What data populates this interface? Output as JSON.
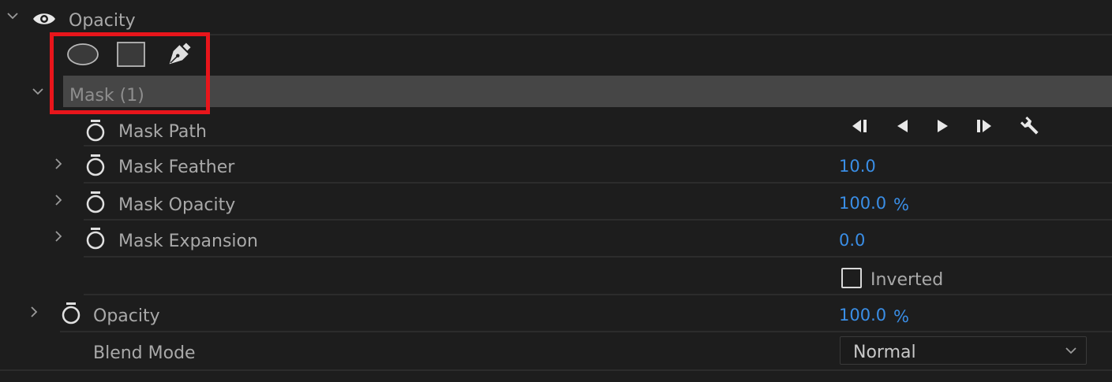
{
  "opacity_header": {
    "label": "Opacity"
  },
  "mask_tools": [
    "ellipse-mask-tool",
    "rectangle-mask-tool",
    "pen-mask-tool"
  ],
  "mask": {
    "name": "Mask (1)",
    "path": {
      "label": "Mask Path"
    },
    "feather": {
      "label": "Mask Feather",
      "value": "10.0"
    },
    "opacity": {
      "label": "Mask Opacity",
      "value": "100.0",
      "unit": "%"
    },
    "expansion": {
      "label": "Mask Expansion",
      "value": "0.0"
    },
    "inverted": {
      "label": "Inverted",
      "checked": false
    }
  },
  "opacity_param": {
    "label": "Opacity",
    "value": "100.0",
    "unit": "%"
  },
  "blend_mode": {
    "label": "Blend Mode",
    "selected": "Normal"
  },
  "colors": {
    "value_blue": "#3a8ee6",
    "highlight_red": "#e8151b",
    "mask_row_bg": "#464646"
  }
}
